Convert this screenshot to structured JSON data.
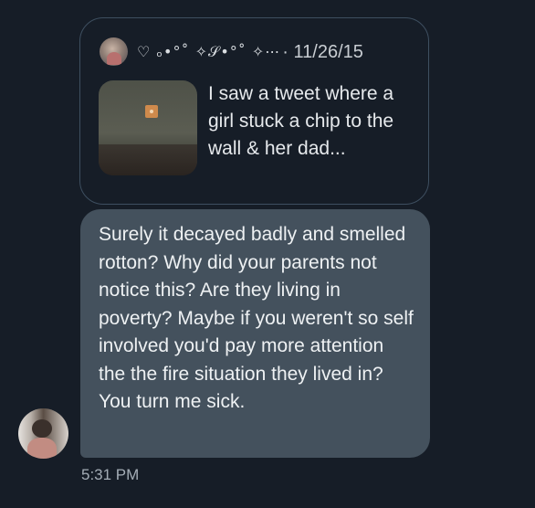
{
  "quoted_tweet": {
    "display_name": "♡ ₒ•°˚ ✧𝒮•°˚ ✧⋯",
    "date": "· 11/26/15",
    "text": "I saw a tweet where a girl stuck a chip to the wall & her dad..."
  },
  "reply": {
    "text": "Surely it decayed badly and smelled rotton? Why did your parents not notice this? Are they living in poverty? Maybe if you weren't so self involved you'd pay more attention the the fire situation they lived in? You turn me sick.",
    "time": "5:31 PM"
  },
  "colors": {
    "background": "#161d27",
    "bubble": "#44515d",
    "card_border": "#3e4f60"
  }
}
